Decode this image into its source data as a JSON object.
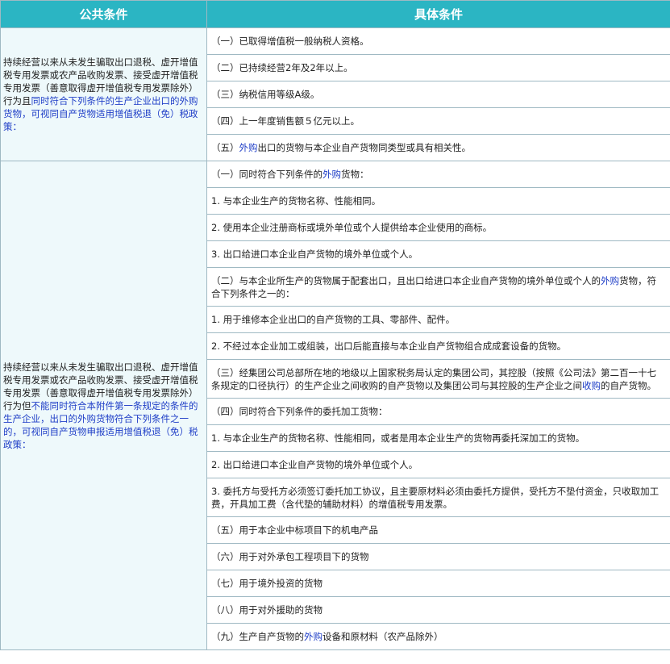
{
  "header": {
    "col1": "公共条件",
    "col2": "具体条件"
  },
  "group1": {
    "common": {
      "pre": "持续经营以来从未发生骗取出口退税、虚开增值税专用发票或农产品收购发票、接受虚开增值税专用发票（善意取得虚开增值税专用发票除外）行为且",
      "blue": "同时符合下列条件的生产企业出口的外购货物，可视同自产货物适用增值税退（免）税政策："
    },
    "rows": [
      {
        "text": "（一）已取得增值税一般纳税人资格。"
      },
      {
        "text": "（二）已持续经营2年及2年以上。"
      },
      {
        "text": "（三）纳税信用等级A级。"
      },
      {
        "text": "（四）上一年度销售额５亿元以上。"
      },
      {
        "pre": "（五）",
        "blue": "外购",
        "post": "出口的货物与本企业自产货物同类型或具有相关性。"
      }
    ]
  },
  "group2": {
    "common": {
      "pre": "持续经营以来从未发生骗取出口退税、虚开增值税专用发票或农产品收购发票、接受虚开增值税专用发票（善意取得虚开增值税专用发票除外）行为但",
      "blue": "不能同时符合本附件第一条规定的条件的生产企业，出口的外购货物符合下列条件之一的，可视同自产货物申报适用增值税退（免）税政策："
    },
    "rows": [
      {
        "pre": "（一）同时符合下列条件的",
        "blue": "外购",
        "post": "货物："
      },
      {
        "text": "1. 与本企业生产的货物名称、性能相同。"
      },
      {
        "text": "2. 使用本企业注册商标或境外单位或个人提供给本企业使用的商标。"
      },
      {
        "text": "3. 出口给进口本企业自产货物的境外单位或个人。"
      },
      {
        "pre": "（二）与本企业所生产的货物属于配套出口，且出口给进口本企业自产货物的境外单位或个人的",
        "blue": "外购",
        "post": "货物，符合下列条件之一的："
      },
      {
        "text": "1. 用于维修本企业出口的自产货物的工具、零部件、配件。"
      },
      {
        "text": "2. 不经过本企业加工或组装，出口后能直接与本企业自产货物组合成成套设备的货物。"
      },
      {
        "pre": "（三）经集团公司总部所在地的地级以上国家税务局认定的集团公司，其控股（按照《公司法》第二百一十七条规定的口径执行）的生产企业之间收购的自产货物以及集团公司与其控股的生产企业之间",
        "blue": "收购",
        "post": "的自产货物。"
      },
      {
        "text": "（四）同时符合下列条件的委托加工货物："
      },
      {
        "text": "1. 与本企业生产的货物名称、性能相同，或者是用本企业生产的货物再委托深加工的货物。"
      },
      {
        "text": "2. 出口给进口本企业自产货物的境外单位或个人。"
      },
      {
        "text": "3. 委托方与受托方必须签订委托加工协议，且主要原材料必须由委托方提供，受托方不垫付资金，只收取加工费，开具加工费（含代垫的辅助材料）的增值税专用发票。"
      },
      {
        "text": "（五）用于本企业中标项目下的机电产品"
      },
      {
        "text": "（六）用于对外承包工程项目下的货物"
      },
      {
        "text": "（七）用于境外投资的货物"
      },
      {
        "text": "（八）用于对外援助的货物"
      },
      {
        "pre": "（九）生产自产货物的",
        "blue": "外购",
        "post": "设备和原材料（农产品除外）"
      }
    ]
  }
}
